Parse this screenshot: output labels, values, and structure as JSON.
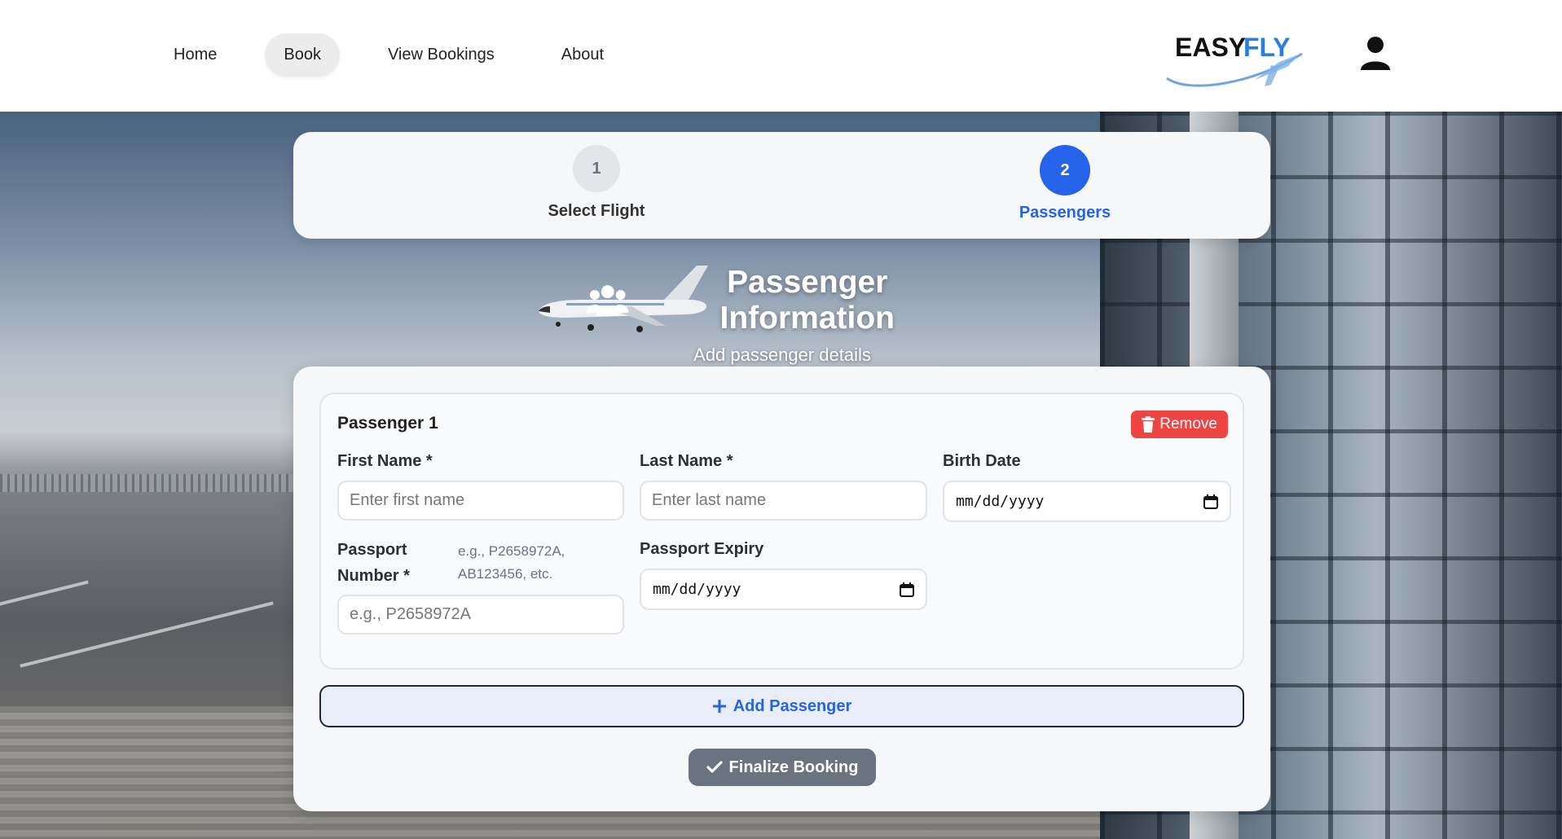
{
  "nav": {
    "items": [
      {
        "label": "Home",
        "active": false
      },
      {
        "label": "Book",
        "active": true
      },
      {
        "label": "View Bookings",
        "active": false
      },
      {
        "label": "About",
        "active": false
      }
    ],
    "logo_text": "EASYFLY",
    "logo_text_dark": "EASY",
    "logo_text_accent": "FLY"
  },
  "colors": {
    "accent": "#2563eb",
    "danger": "#ef4444",
    "muted_button": "#6b7280"
  },
  "stepper": {
    "steps": [
      {
        "number": "1",
        "label": "Select Flight",
        "active": false
      },
      {
        "number": "2",
        "label": "Passengers",
        "active": true
      }
    ]
  },
  "page": {
    "title": "Passenger Information",
    "subtitle": "Add passenger details",
    "title_icon": "users-icon"
  },
  "passenger": {
    "heading": "Passenger 1",
    "remove_label": "Remove",
    "first_name": {
      "label": "First Name *",
      "placeholder": "Enter first name",
      "value": ""
    },
    "last_name": {
      "label": "Last Name *",
      "placeholder": "Enter last name",
      "value": ""
    },
    "birth_date": {
      "label": "Birth Date",
      "placeholder": "mm/dd/yyyy"
    },
    "passport_number": {
      "label_line1": "Passport",
      "label_line2": "Number *",
      "hint_line1": "e.g., P2658972A,",
      "hint_line2": "AB123456, etc.",
      "placeholder": "e.g., P2658972A",
      "value": ""
    },
    "passport_expiry": {
      "label": "Passport Expiry",
      "placeholder": "mm/dd/yyyy"
    }
  },
  "actions": {
    "add_passenger": "Add Passenger",
    "finalize_booking": "Finalize Booking"
  }
}
